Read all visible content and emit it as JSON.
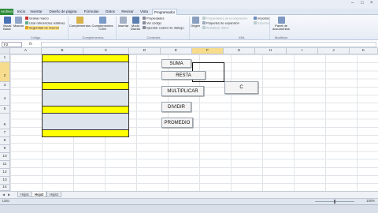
{
  "tabs": [
    {
      "label": "Archivo",
      "file": true
    },
    {
      "label": "Inicio"
    },
    {
      "label": "Insertar"
    },
    {
      "label": "Diseño de página"
    },
    {
      "label": "Fórmulas"
    },
    {
      "label": "Datos"
    },
    {
      "label": "Revisar"
    },
    {
      "label": "Vista"
    },
    {
      "label": "Programador",
      "active": true
    }
  ],
  "ribbon": {
    "visual_basic": "Visual Basic",
    "macros": "Macros",
    "grabar_macro": "Grabar macro",
    "usar_ref": "Usar referencias relativas",
    "seguridad": "Seguridad de macros",
    "group_codigo": "Código",
    "complementos": "Complementos",
    "complementos_com": "Complementos COM",
    "group_complementos": "Complementos",
    "insertar": "Insertar",
    "modo_diseno": "Modo Diseño",
    "propiedades": "Propiedades",
    "ver_codigo": "Ver código",
    "ejecutar_cuadro": "Ejecutar cuadro de diálogo",
    "group_controles": "Controles",
    "origen": "Origen",
    "prop_asignacion": "Propiedades de la asignación",
    "paquetes": "Paquetes de expansión",
    "actualizar": "Actualizar datos",
    "importar": "Importar",
    "exportar": "Exportar",
    "group_xml": "XML",
    "panel_doc": "Panel de documentos",
    "group_modificar": "Modificar"
  },
  "namebox": "F2",
  "fx": "fx",
  "columns": [
    "A",
    "B",
    "C",
    "D",
    "E",
    "F",
    "G",
    "H",
    "I",
    "J",
    "K"
  ],
  "rows": [
    "1",
    "2",
    "3",
    "4",
    "5",
    "6",
    "7",
    "8",
    "9",
    "10",
    "11",
    "12",
    "13",
    "14",
    "15",
    "16",
    "17"
  ],
  "buttons": {
    "suma": "SUMA",
    "resta": "RESTA",
    "multiplicar": "MULTIPLICAR",
    "dividir": "DIVIDIR",
    "promedio": "PROMEDIO",
    "c": "C"
  },
  "sheets": [
    {
      "label": "Hoja1"
    },
    {
      "label": "Hoja2",
      "active": true
    },
    {
      "label": "Hoja3"
    }
  ],
  "status": "Listo",
  "zoom": "100%",
  "colors": {
    "yellow": "#ffff00",
    "cellblue": "#dde4ec",
    "file_tab": "#2e8b3a"
  }
}
